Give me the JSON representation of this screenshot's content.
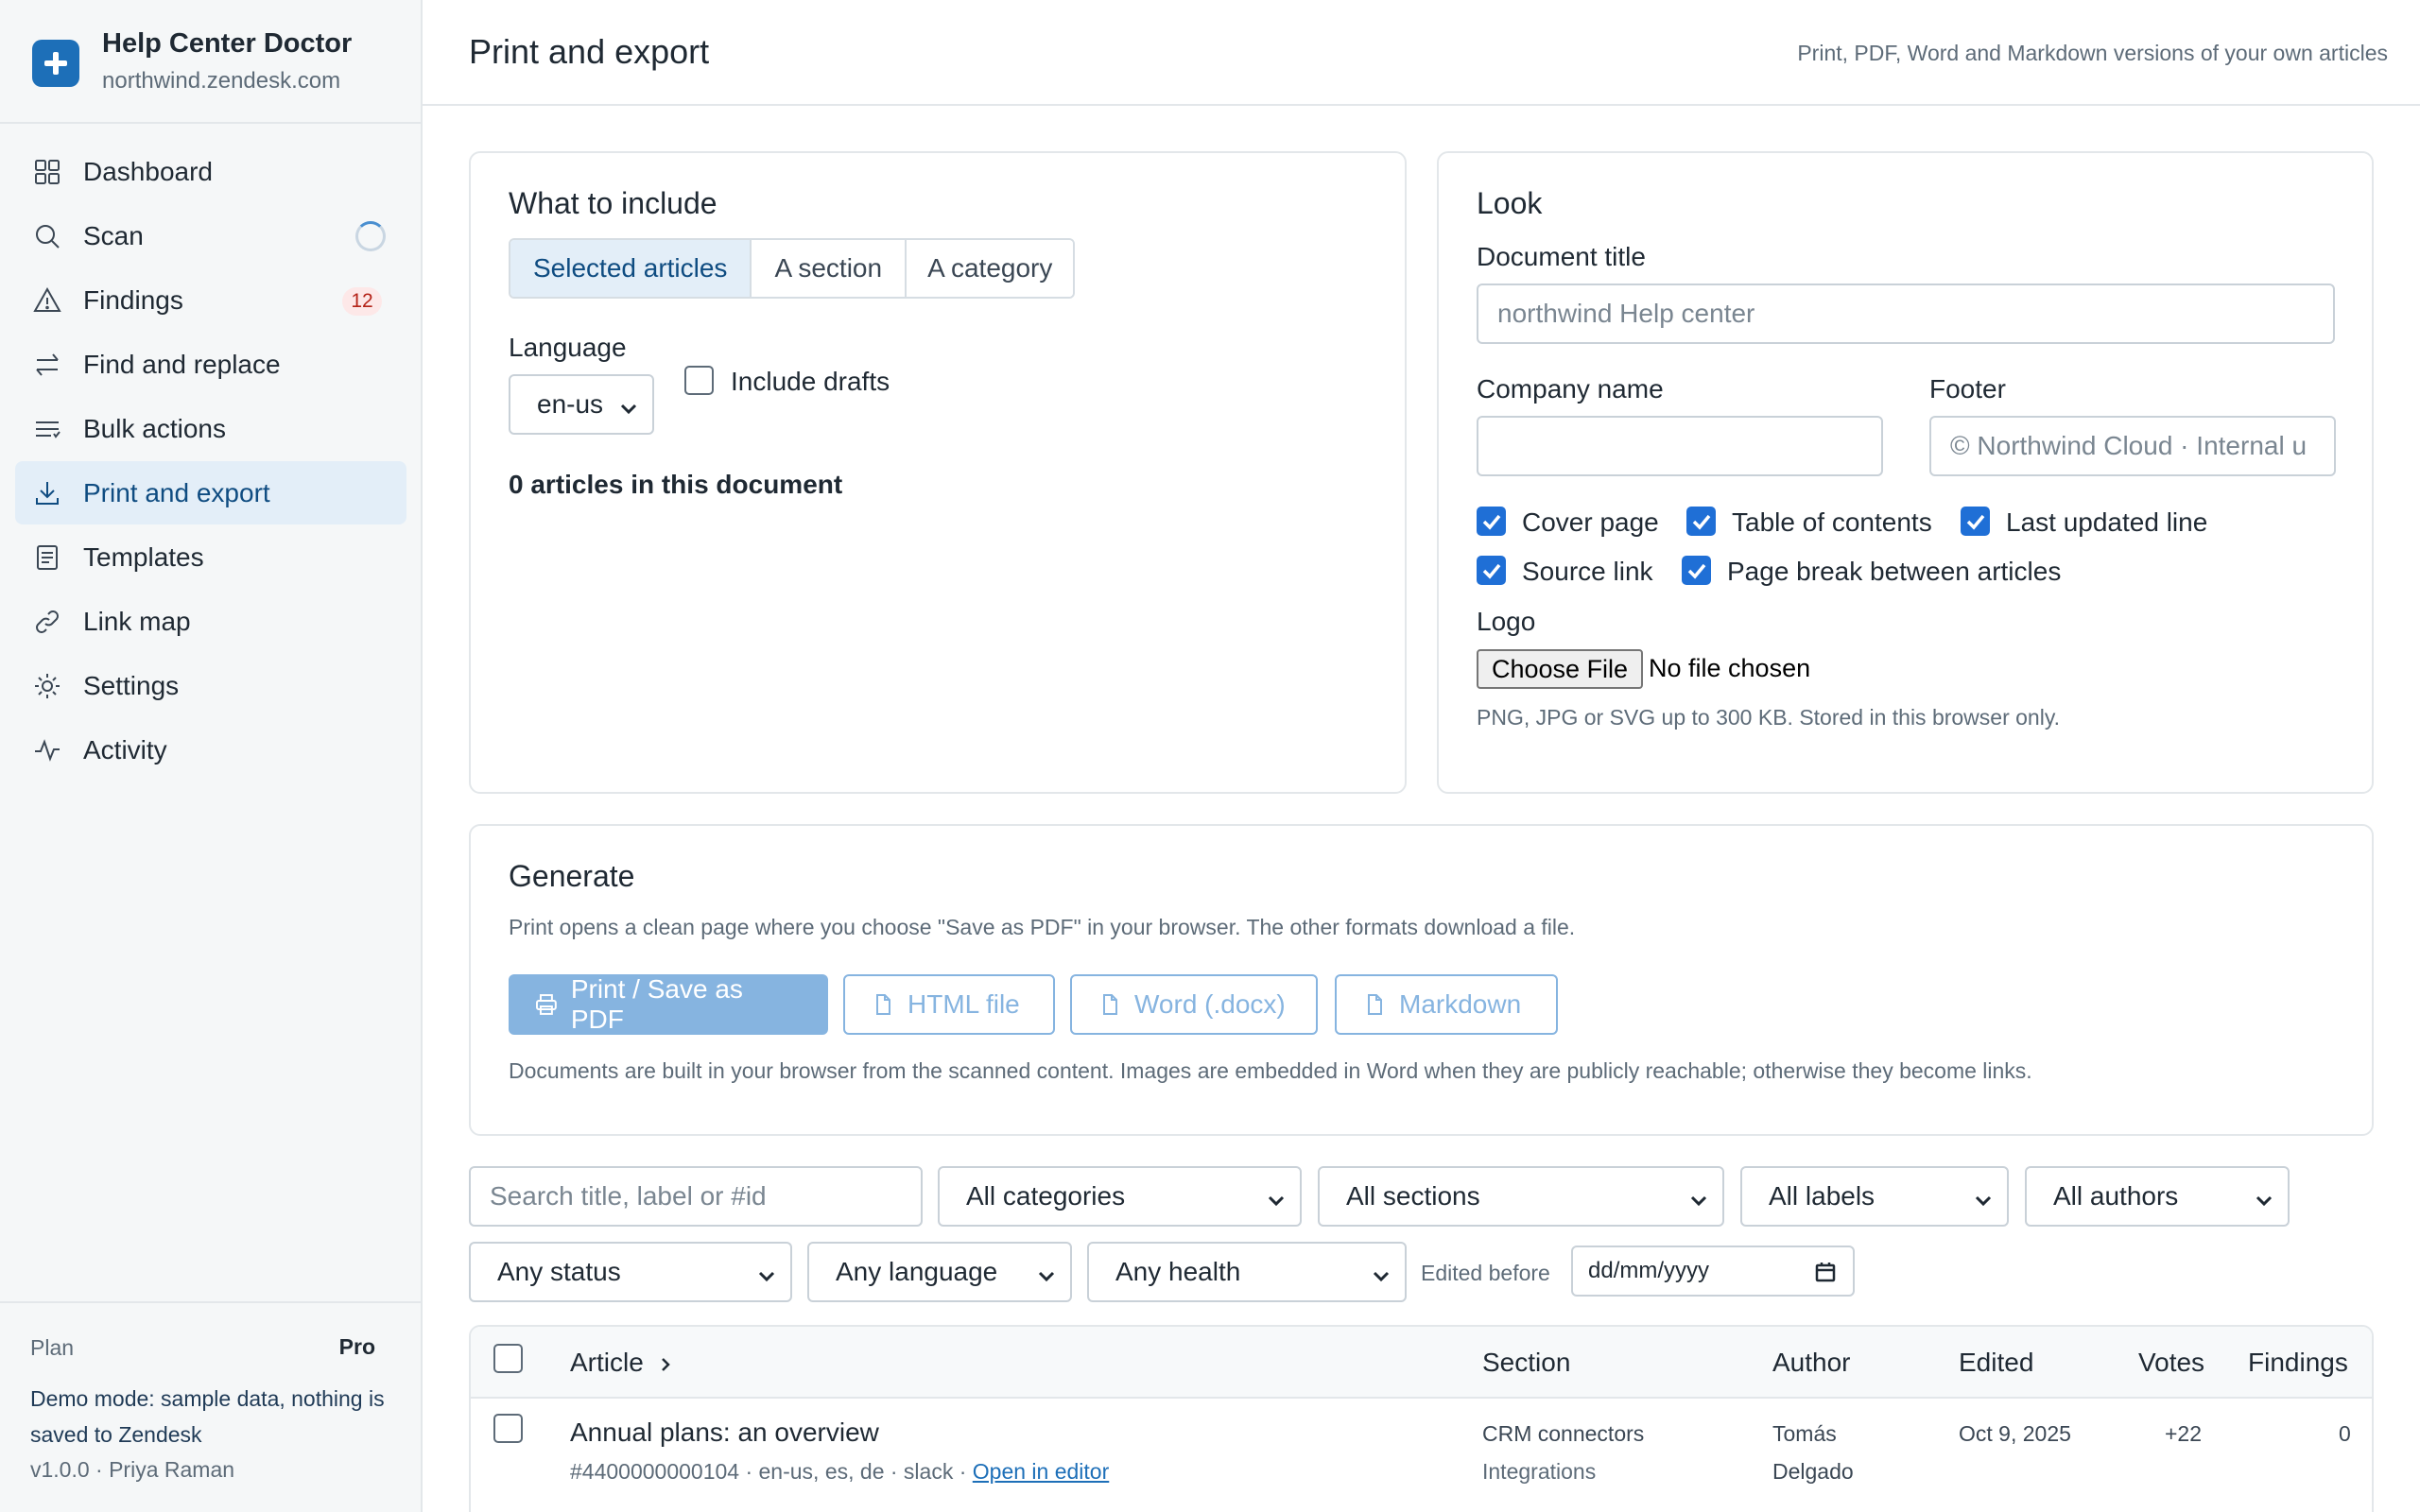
{
  "app": {
    "name": "Help Center Doctor",
    "domain": "northwind.zendesk.com"
  },
  "nav": [
    {
      "label": "Dashboard",
      "icon": "grid-icon"
    },
    {
      "label": "Scan",
      "icon": "search-icon"
    },
    {
      "label": "Findings",
      "icon": "warning-icon",
      "badge": "12"
    },
    {
      "label": "Find and replace",
      "icon": "swap-icon"
    },
    {
      "label": "Bulk actions",
      "icon": "list-icon"
    },
    {
      "label": "Print and export",
      "icon": "download-icon",
      "active": true
    },
    {
      "label": "Templates",
      "icon": "document-icon"
    },
    {
      "label": "Link map",
      "icon": "link-icon"
    },
    {
      "label": "Settings",
      "icon": "gear-icon"
    },
    {
      "label": "Activity",
      "icon": "activity-icon"
    }
  ],
  "plan": {
    "label": "Plan",
    "tier": "Pro",
    "demo_note": "Demo mode: sample data, nothing is saved to Zendesk",
    "version": "v1.0.0 · Priya Raman"
  },
  "header": {
    "title": "Print and export",
    "subtitle": "Print, PDF, Word and Markdown versions of your own articles"
  },
  "include": {
    "title": "What to include",
    "modes": [
      "Selected articles",
      "A section",
      "A category"
    ],
    "active_mode": "Selected articles",
    "language_label": "Language",
    "language_value": "en-us",
    "drafts_label": "Include drafts",
    "drafts_checked": false,
    "count_text": "0 articles in this document"
  },
  "look": {
    "title": "Look",
    "doc_title_label": "Document title",
    "doc_title_placeholder": "northwind Help center",
    "company_label": "Company name",
    "company_value": "",
    "footer_label": "Footer",
    "footer_placeholder": "© Northwind Cloud · Internal u",
    "options": [
      {
        "label": "Cover page",
        "checked": true
      },
      {
        "label": "Table of contents",
        "checked": true
      },
      {
        "label": "Last updated line",
        "checked": true
      },
      {
        "label": "Source link",
        "checked": true
      },
      {
        "label": "Page break between articles",
        "checked": true
      }
    ],
    "logo_label": "Logo",
    "file_button": "Choose File",
    "file_status": "No file chosen",
    "logo_hint": "PNG, JPG or SVG up to 300 KB. Stored in this browser only."
  },
  "generate": {
    "title": "Generate",
    "description": "Print opens a clean page where you choose \"Save as PDF\" in your browser. The other formats download a file.",
    "buttons": [
      "Print / Save as PDF",
      "HTML file",
      "Word (.docx)",
      "Markdown"
    ],
    "note": "Documents are built in your browser from the scanned content. Images are embedded in Word when they are publicly reachable; otherwise they become links."
  },
  "filters": {
    "search_placeholder": "Search title, label or #id",
    "category": "All categories",
    "section": "All sections",
    "labels": "All labels",
    "authors": "All authors",
    "status": "Any status",
    "language": "Any language",
    "health": "Any health",
    "edited_before_label": "Edited before",
    "date_placeholder": "dd/mm/yyyy"
  },
  "table": {
    "columns": [
      "Article",
      "Section",
      "Author",
      "Edited",
      "Votes",
      "Findings"
    ],
    "rows": [
      {
        "title": "Annual plans: an overview",
        "meta": "#4400000000104 · en-us, es, de · slack · ",
        "open_link": "Open in editor",
        "section": "CRM connectors",
        "category": "Integrations",
        "author_first": "Tomás",
        "author_last": "Delgado",
        "edited": "Oct 9, 2025",
        "votes": "+22",
        "findings": "0"
      }
    ]
  },
  "colors": {
    "accent": "#1d6fb8",
    "active_bg": "#e3eef8",
    "disabled_btn": "#86b4e0",
    "checkbox": "#1f6fd6"
  }
}
